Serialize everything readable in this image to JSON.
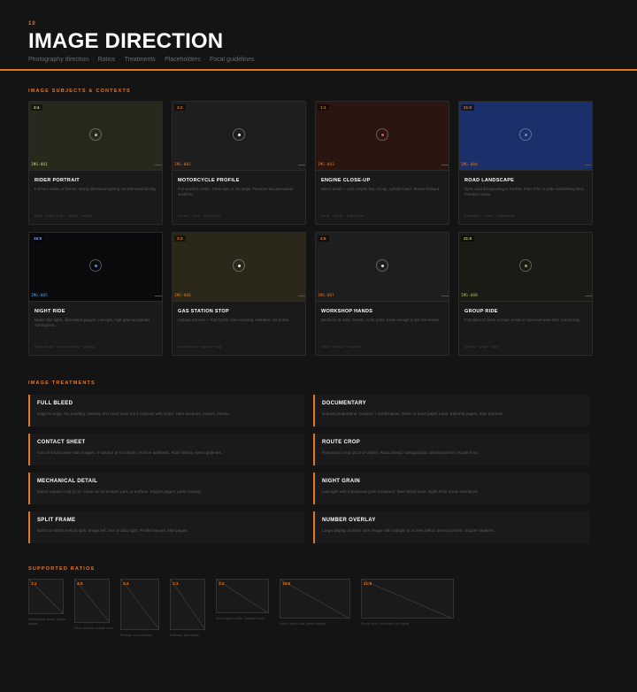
{
  "header": {
    "page_number": "10",
    "title": "IMAGE DIRECTION",
    "subtitle_items": [
      "Photography direction",
      "Ratios",
      "Treatments",
      "Placeholders",
      "Focal guidelines"
    ],
    "separator": "·"
  },
  "subjects": {
    "label": "IMAGE SUBJECTS & CONTEXTS",
    "cards": [
      {
        "ratio": "3:4",
        "code": "IMG-001",
        "name": "RIDER PORTRAIT",
        "desc": "Full face visible or helmet; strong directional lighting. No distracted identity.",
        "tags": "Bust, chest-front · gritty · urban",
        "bg": "#262a1d",
        "accent": "#c9d98a",
        "dot": "#b5c46a"
      },
      {
        "ratio": "3:2",
        "code": "IMG-002",
        "name": "MOTORCYCLE PROFILE",
        "desc": "Full machine visible. Clean side or 3/4 angle. Precision documentation aesthetic.",
        "tags": "Clean · neat · technical",
        "bg": "#1e1e1f",
        "accent": "#e87722",
        "dot": "#ffffff"
      },
      {
        "ratio": "1:1",
        "code": "IMG-003",
        "name": "ENGINE CLOSE-UP",
        "desc": "Macro detail — carb, engine fins, oil cap, cylinder head. Texture-forward.",
        "tags": "Neat · gritty · industrial",
        "bg": "#2a1510",
        "accent": "#e87722",
        "dot": "#e8552a"
      },
      {
        "ratio": "21:9",
        "code": "IMG-004",
        "name": "ROAD LANDSCAPE",
        "desc": "Open road disappearing to horizon. Rider POV or wide establishing shot. Freedom visual.",
        "tags": "Freedom · wide · expansive",
        "bg": "#1b2f6b",
        "accent": "#e87722",
        "dot": "#4a8cff"
      },
      {
        "ratio": "16:9",
        "code": "IMG-005",
        "name": "NIGHT RIDE",
        "desc": "Motion blur lights, illuminated gauges. Low-light, high-grain acceptable. Atmospheric.",
        "tags": "Blue-black · neon accent · grainy",
        "bg": "#0a0a0d",
        "accent": "#6aa8ff",
        "dot": "#4a8cff"
      },
      {
        "ratio": "3:2",
        "code": "IMG-006",
        "name": "GAS STATION STOP",
        "desc": "Cultural moment — fuel nozzle, bike crowding. Narrative, not posed.",
        "tags": "Americana · warm · real",
        "bg": "#2b2819",
        "accent": "#e87722",
        "dot": "#ffffff"
      },
      {
        "ratio": "4:5",
        "code": "IMG-007",
        "name": "WORKSHOP HANDS",
        "desc": "Mechanic at work. Grease, tools, parts. Close enough to feel the texture.",
        "tags": "Neat · tactile · honest",
        "bg": "#1e1e1f",
        "accent": "#e87722",
        "dot": "#dddddd"
      },
      {
        "ratio": "21:9",
        "code": "IMG-008",
        "name": "GROUP RIDE",
        "desc": "Formation of riders on road. Aerial or road-level wide shot. Community.",
        "tags": "Aerial · wide · flow",
        "bg": "#1a1b14",
        "accent": "#b5c46a",
        "dot": "#9aa864"
      }
    ]
  },
  "treatments": {
    "label": "IMAGE TREATMENTS",
    "items": [
      {
        "name": "FULL BLEED",
        "desc": "Edge-to-edge. No padding. Overlay text must pass 4.5:1 contrast with scrim. Hero sections, covers, events."
      },
      {
        "name": "DOCUMENTARY",
        "desc": "Natural proportions. Caption + credit below. White or base paper base. Editorial pages, rider journals."
      },
      {
        "name": "CONTACT SHEET",
        "desc": "Grid of small same-ratio images. 4-column or 6-column. Archive aesthetic. Ride history, event galleries."
      },
      {
        "name": "ROUTE CROP",
        "desc": "Panoramic crop (21:9 or wider). Road ahead. Navigational, directional feel. Route hero."
      },
      {
        "name": "MECHANICAL DETAIL",
        "desc": "Macro square crop (1:1). Close-up on texture, part, or surface. Engine pages, parts catalog."
      },
      {
        "name": "NIGHT GRAIN",
        "desc": "Low-light with intentional grain treatment. Blue-black base. Night Ride mode interfaces."
      },
      {
        "name": "SPLIT FRAME",
        "desc": "50/50 or 60/40 vertical split. Image left, text or data right. Profile layouts, bike pages."
      },
      {
        "name": "NUMBER OVERLAY",
        "desc": "Large display number over image with multiply or screen blend. Event posters, chapter markers."
      }
    ]
  },
  "ratios": {
    "label": "SUPPORTED RATIOS",
    "items": [
      {
        "ratio": "1:1",
        "caption": "Mechanical detail, profile avatar"
      },
      {
        "ratio": "4:5",
        "caption": "Rider portrait, mobile hero"
      },
      {
        "ratio": "3:4",
        "caption": "Portrait, documentary"
      },
      {
        "ratio": "2:3",
        "caption": "Editorial, tall inserts"
      },
      {
        "ratio": "3:2",
        "caption": "Motorcycle profile, standard card"
      },
      {
        "ratio": "16:9",
        "caption": "Video, wide card, event banner"
      },
      {
        "ratio": "21:9",
        "caption": "Route hero, cinematic, full bleed"
      }
    ]
  },
  "colors": {
    "accent": "#e87722",
    "background": "#141414",
    "card": "#1a1a1a"
  }
}
